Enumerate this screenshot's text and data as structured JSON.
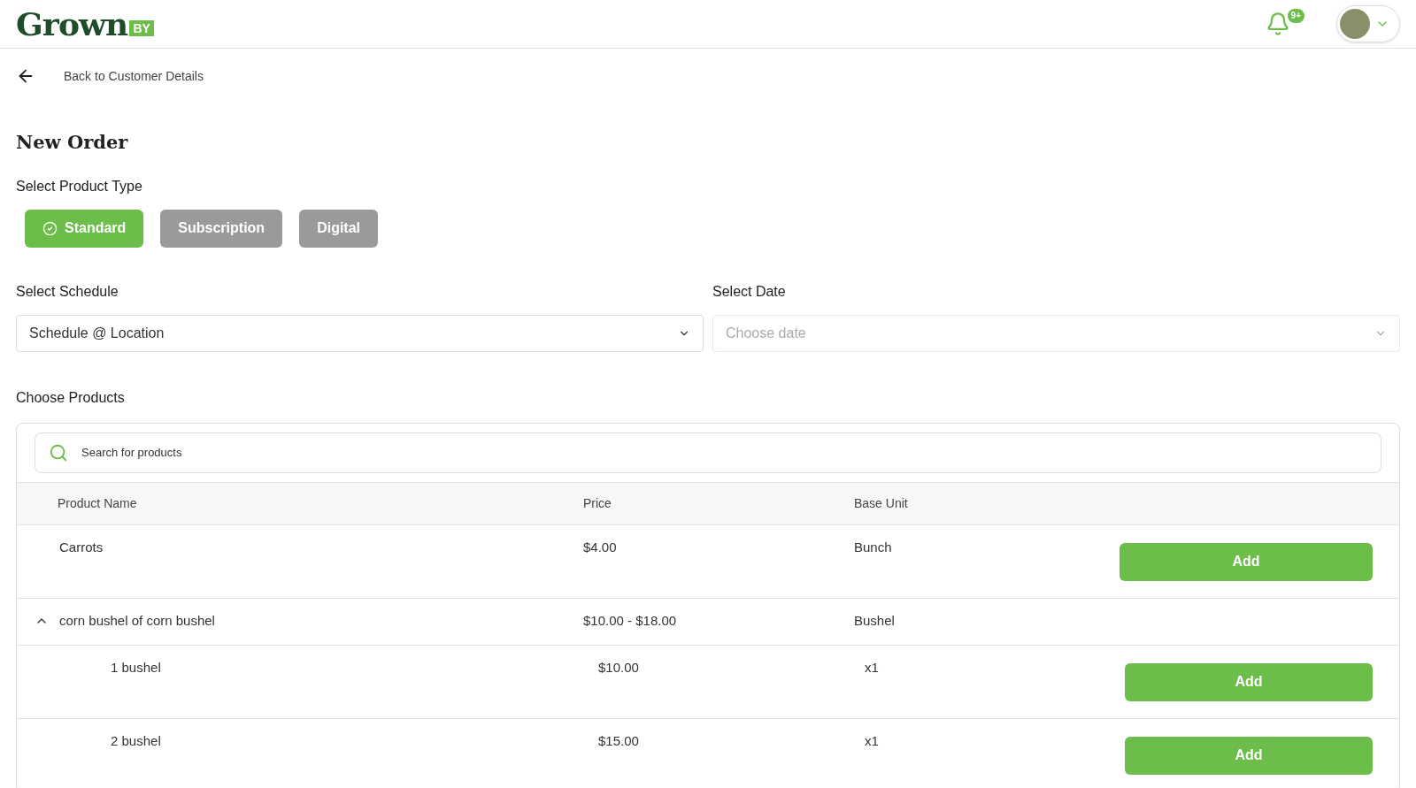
{
  "header": {
    "logo": {
      "word": "Grown",
      "tag": "BY"
    },
    "notification_badge": "9+"
  },
  "back_link": "Back to Customer Details",
  "title": "New Order",
  "product_type": {
    "label": "Select Product Type",
    "options": [
      {
        "label": "Standard",
        "selected": true
      },
      {
        "label": "Subscription",
        "selected": false
      },
      {
        "label": "Digital",
        "selected": false
      }
    ]
  },
  "schedule": {
    "label": "Select Schedule",
    "value": "Schedule @ Location"
  },
  "date": {
    "label": "Select Date",
    "placeholder": "Choose date"
  },
  "products": {
    "label": "Choose Products",
    "search_placeholder": "Search for products",
    "columns": [
      "Product Name",
      "Price",
      "Base Unit"
    ],
    "rows": [
      {
        "name": "Carrots",
        "price": "$4.00",
        "unit": "Bunch",
        "action": "Add"
      },
      {
        "name": "corn bushel of corn bushel",
        "price": "$10.00 - $18.00",
        "unit": "Bushel",
        "expanded": true,
        "children": [
          {
            "name": "1 bushel",
            "price": "$10.00",
            "unit": "x1",
            "action": "Add"
          },
          {
            "name": "2 bushel",
            "price": "$15.00",
            "unit": "x1",
            "action": "Add"
          }
        ]
      }
    ]
  }
}
